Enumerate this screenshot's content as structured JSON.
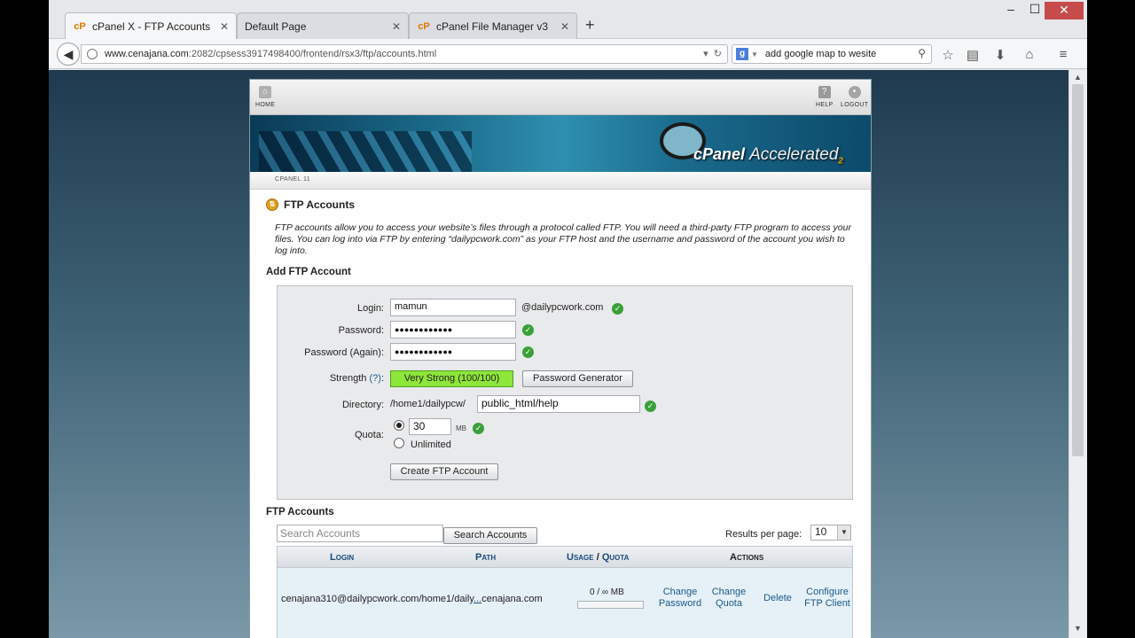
{
  "browser": {
    "tabs": [
      {
        "icon": "cP",
        "label": "cPanel X - FTP Accounts",
        "active": true
      },
      {
        "icon": "page",
        "label": "Default Page",
        "active": false
      },
      {
        "icon": "cP",
        "label": "cPanel File Manager v3",
        "active": false
      }
    ],
    "new_tab": "+",
    "url": {
      "host": "www.cenajana.com",
      "path": ":2082/cpsess3917498400/frontend/rsx3/ftp/accounts.html"
    },
    "search": {
      "engine": "g",
      "query": "add google map to wesite"
    }
  },
  "cpanel": {
    "top_icons": {
      "home": "HOME",
      "help": "HELP",
      "logout": "LOGOUT"
    },
    "logo": {
      "brand": "cPanel",
      "edition": "Accelerated",
      "version": "2"
    },
    "crumb": "CPANEL 11",
    "title": "FTP Accounts",
    "intro": "FTP accounts allow you to access your website’s files through a protocol called FTP. You will need a third-party FTP program to access your files. You can log into via FTP by entering “dailypcwork.com” as your FTP host and the username and password of the account you wish to log into.",
    "add_section": "Add FTP Account",
    "form": {
      "login_label": "Login:",
      "login_value": "mamun",
      "login_domain": "@dailypcwork.com",
      "password_label": "Password:",
      "password_value": "●●●●●●●●●●●●",
      "password_again_label": "Password (Again):",
      "password_again_value": "●●●●●●●●●●●●",
      "strength_label": "Strength",
      "strength_help": "(?)",
      "strength_colon": ":",
      "strength_value": "Very Strong (100/100)",
      "password_generator": "Password Generator",
      "directory_label": "Directory:",
      "directory_prefix": "/home1/dailypcw/",
      "directory_value": "public_html/help",
      "quota_label": "Quota:",
      "quota_value": "30",
      "quota_unit": "MB",
      "unlimited_label": "Unlimited",
      "create_button": "Create FTP Account"
    },
    "accounts_section": "FTP Accounts",
    "search_placeholder": "Search Accounts",
    "search_button": "Search Accounts",
    "results_per_page_label": "Results per page:",
    "results_per_page_value": "10",
    "table": {
      "headers": {
        "login": "Login",
        "path": "Path",
        "usage": "Usage",
        "slash": "/",
        "quota": "Quota",
        "actions": "Actions"
      },
      "rows": [
        {
          "account_start": "cenajana310@dailypcwork.com/home1/daily",
          "ellipsis": "...",
          "account_end": "cenajana.com",
          "usage": "0 / ∞ MB",
          "actions": {
            "change_password": [
              "Change",
              "Password"
            ],
            "change_quota": [
              "Change",
              "Quota"
            ],
            "delete": "Delete",
            "configure": [
              "Configure",
              "FTP Client"
            ]
          }
        }
      ]
    }
  }
}
